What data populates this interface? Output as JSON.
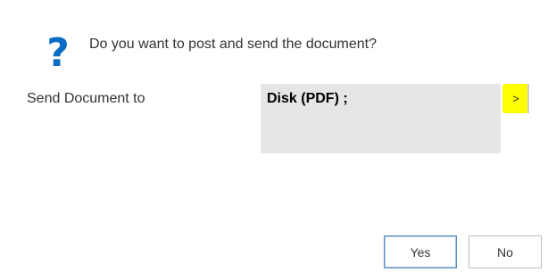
{
  "dialog": {
    "question_icon_name": "question-mark-icon",
    "question_icon_glyph": "?",
    "question": "Do you want to post and send the document?",
    "field_label": "Send Document to",
    "field_value": "Disk (PDF) ;",
    "assist_button_label": ">",
    "yes_label": "Yes",
    "no_label": "No"
  },
  "colors": {
    "icon_blue": "#0a6cc2",
    "field_background": "#e6e6e6",
    "highlight": "#ffff00"
  }
}
